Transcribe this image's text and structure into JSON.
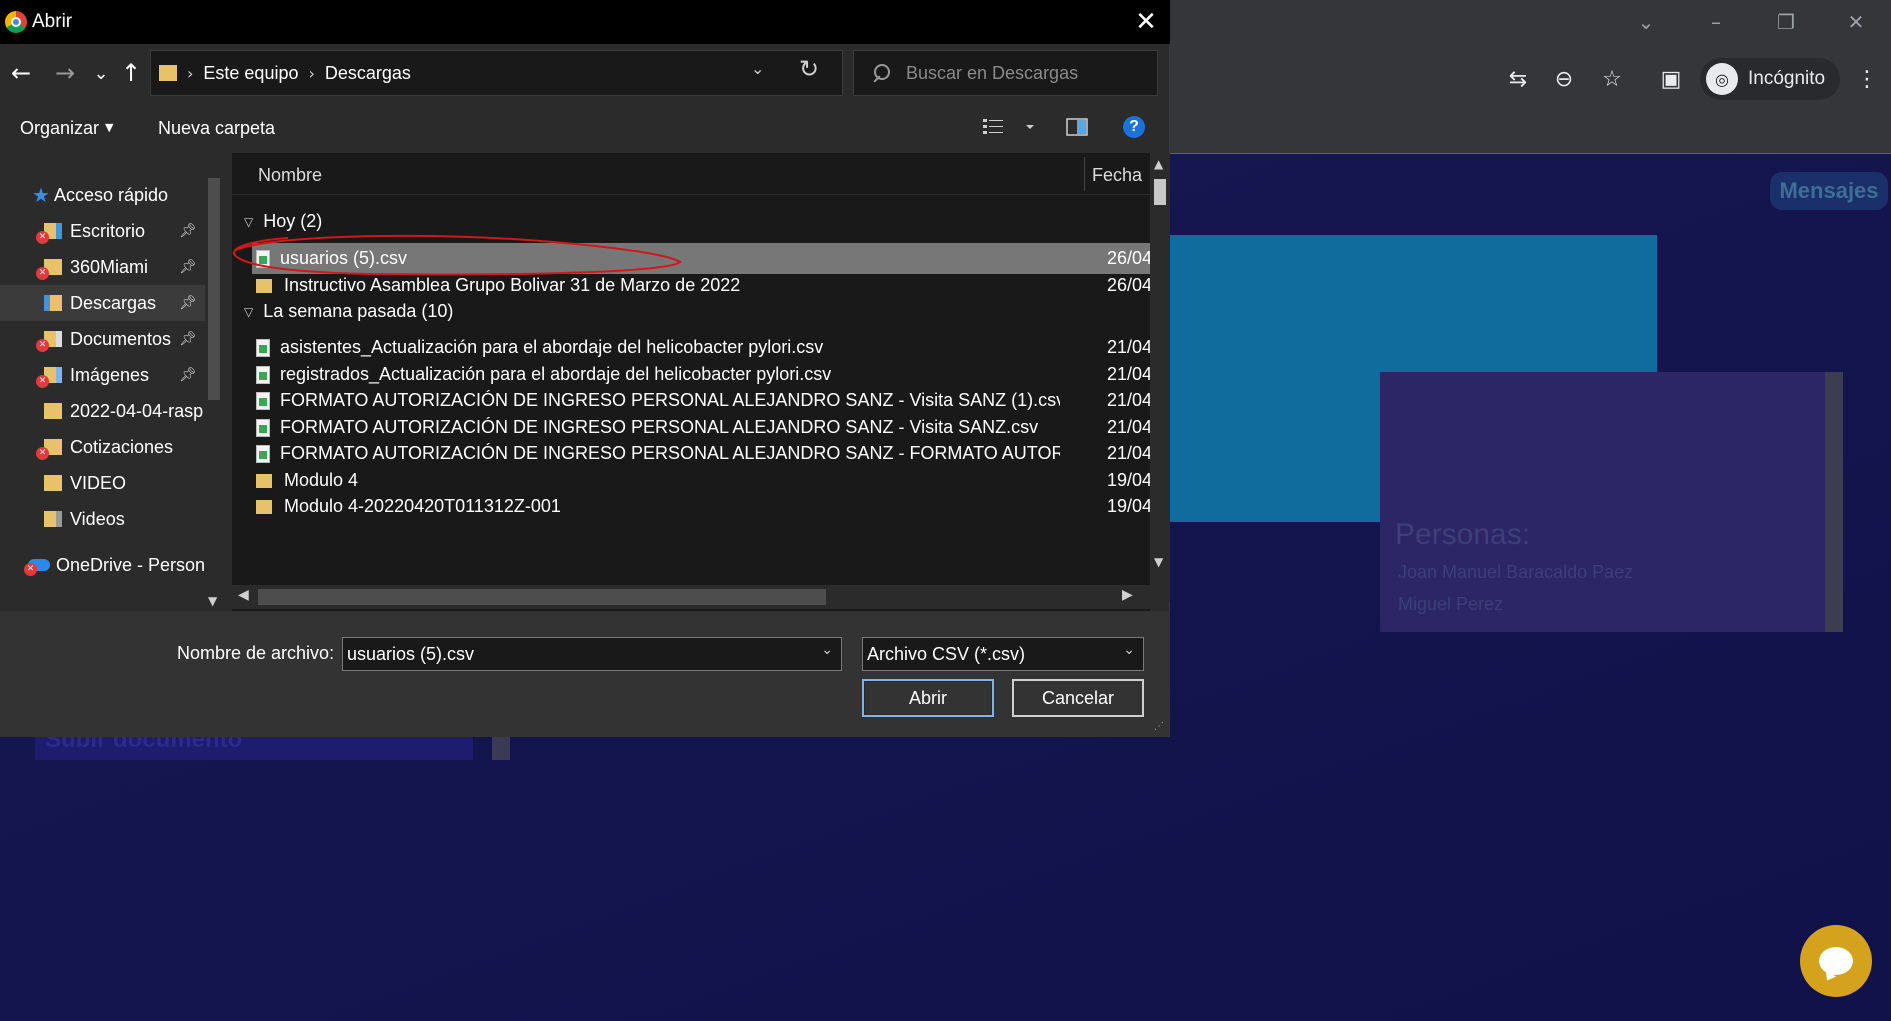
{
  "dialog": {
    "title": "Abrir",
    "close": "✕",
    "nav": {
      "back": "←",
      "forward": "→",
      "recent": "⌄",
      "up": "↑"
    },
    "address": {
      "sep": "›",
      "crumbs": [
        "Este equipo",
        "Descargas"
      ],
      "dropdown": "⌄",
      "refresh": "↻"
    },
    "search": {
      "placeholder": "Buscar en Descargas"
    },
    "commands": {
      "organize": "Organizar",
      "new_folder": "Nueva carpeta",
      "help": "?"
    },
    "nav_pane": [
      {
        "label": "Acceso rápido",
        "icon": "star-icon"
      },
      {
        "label": "Escritorio",
        "icon": "desktop-folder-icon",
        "pinned": true,
        "error": true
      },
      {
        "label": "360Miami",
        "icon": "folder-icon",
        "pinned": true,
        "error": true
      },
      {
        "label": "Descargas",
        "icon": "downloads-folder-icon",
        "pinned": true,
        "selected": true
      },
      {
        "label": "Documentos",
        "icon": "documents-folder-icon",
        "pinned": true,
        "error": true
      },
      {
        "label": "Imágenes",
        "icon": "pictures-folder-icon",
        "pinned": true,
        "error": true
      },
      {
        "label": "2022-04-04-rasp",
        "icon": "folder-icon"
      },
      {
        "label": "Cotizaciones",
        "icon": "folder-icon",
        "error": true
      },
      {
        "label": "VIDEO",
        "icon": "folder-icon"
      },
      {
        "label": "Videos",
        "icon": "videos-folder-icon"
      },
      {
        "label": "OneDrive - Person",
        "icon": "onedrive-cloud-icon",
        "error": true
      }
    ],
    "columns": {
      "name": "Nombre",
      "date": "Fecha"
    },
    "groups": [
      {
        "label": "Hoy (2)",
        "files": [
          {
            "name": "usuarios (5).csv",
            "date": "26/04/",
            "type": "csv",
            "selected": true
          },
          {
            "name": "Instructivo Asamblea Grupo Bolivar 31 de Marzo de 2022",
            "date": "26/04/",
            "type": "folder"
          }
        ]
      },
      {
        "label": "La semana pasada (10)",
        "files": [
          {
            "name": "asistentes_Actualización para el abordaje del helicobacter pylori.csv",
            "date": "21/04/",
            "type": "csv"
          },
          {
            "name": "registrados_Actualización para el abordaje del helicobacter pylori.csv",
            "date": "21/04/",
            "type": "csv"
          },
          {
            "name": "FORMATO AUTORIZACIÓN DE INGRESO PERSONAL ALEJANDRO SANZ - Visita SANZ (1).csv",
            "date": "21/04/",
            "type": "csv"
          },
          {
            "name": "FORMATO AUTORIZACIÓN DE INGRESO PERSONAL ALEJANDRO SANZ - Visita SANZ.csv",
            "date": "21/04/",
            "type": "csv"
          },
          {
            "name": "FORMATO AUTORIZACIÓN DE INGRESO PERSONAL ALEJANDRO SANZ - FORMATO AUTORIZAC...",
            "date": "21/04/",
            "type": "csv"
          },
          {
            "name": "Modulo 4",
            "date": "19/04/",
            "type": "folder"
          },
          {
            "name": "Modulo 4-20220420T011312Z-001",
            "date": "19/04/",
            "type": "folder"
          }
        ]
      }
    ],
    "bottom": {
      "filename_label": "Nombre de archivo:",
      "filename_value": "usuarios (5).csv",
      "filetype": "Archivo CSV (*.csv)",
      "open": "Abrir",
      "cancel": "Cancelar"
    },
    "annotation_color": "#d01818"
  },
  "browser": {
    "incognito_label": "Incógnito",
    "page": {
      "mensajes": "Mensajes",
      "personas_title": "Personas:",
      "personas": [
        "Joan Manuel Baracaldo Paez",
        "Miguel Perez"
      ],
      "upload_button": "Subir documento"
    }
  }
}
